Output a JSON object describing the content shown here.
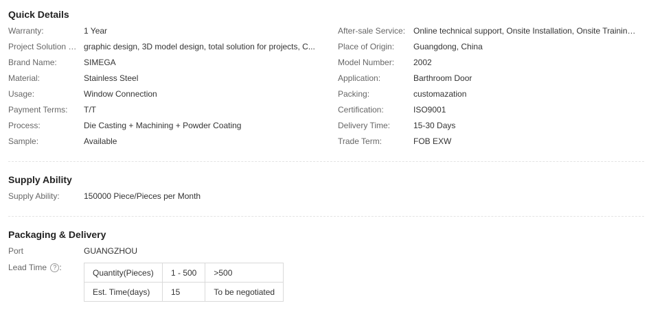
{
  "quick_details": {
    "title": "Quick Details",
    "left": [
      {
        "label": "Warranty:",
        "value": "1 Year"
      },
      {
        "label": "Project Solution Ca...",
        "value": "graphic design, 3D model design, total solution for projects, C..."
      },
      {
        "label": "Brand Name:",
        "value": "SIMEGA"
      },
      {
        "label": "Material:",
        "value": "Stainless Steel"
      },
      {
        "label": "Usage:",
        "value": "Window Connection"
      },
      {
        "label": "Payment Terms:",
        "value": "T/T"
      },
      {
        "label": "Process:",
        "value": "Die Casting + Machining + Powder Coating"
      },
      {
        "label": "Sample:",
        "value": "Available"
      }
    ],
    "right": [
      {
        "label": "After-sale Service:",
        "value": "Online technical support, Onsite Installation, Onsite Training, ..."
      },
      {
        "label": "Place of Origin:",
        "value": "Guangdong, China"
      },
      {
        "label": "Model Number:",
        "value": "2002"
      },
      {
        "label": "Application:",
        "value": "Barthroom Door"
      },
      {
        "label": "Packing:",
        "value": "customazation"
      },
      {
        "label": "Certification:",
        "value": "ISO9001"
      },
      {
        "label": "Delivery Time:",
        "value": "15-30 Days"
      },
      {
        "label": "Trade Term:",
        "value": "FOB EXW"
      }
    ]
  },
  "supply_ability": {
    "title": "Supply Ability",
    "label": "Supply Ability:",
    "value": "150000 Piece/Pieces per Month"
  },
  "packaging_delivery": {
    "title": "Packaging & Delivery",
    "port_label": "Port",
    "port_value": "GUANGZHOU",
    "lead_time_label": "Lead Time",
    "help_icon_glyph": "?",
    "lead_table": {
      "header": [
        "Quantity(Pieces)",
        "1 - 500",
        ">500"
      ],
      "row": [
        "Est. Time(days)",
        "15",
        "To be negotiated"
      ]
    }
  }
}
